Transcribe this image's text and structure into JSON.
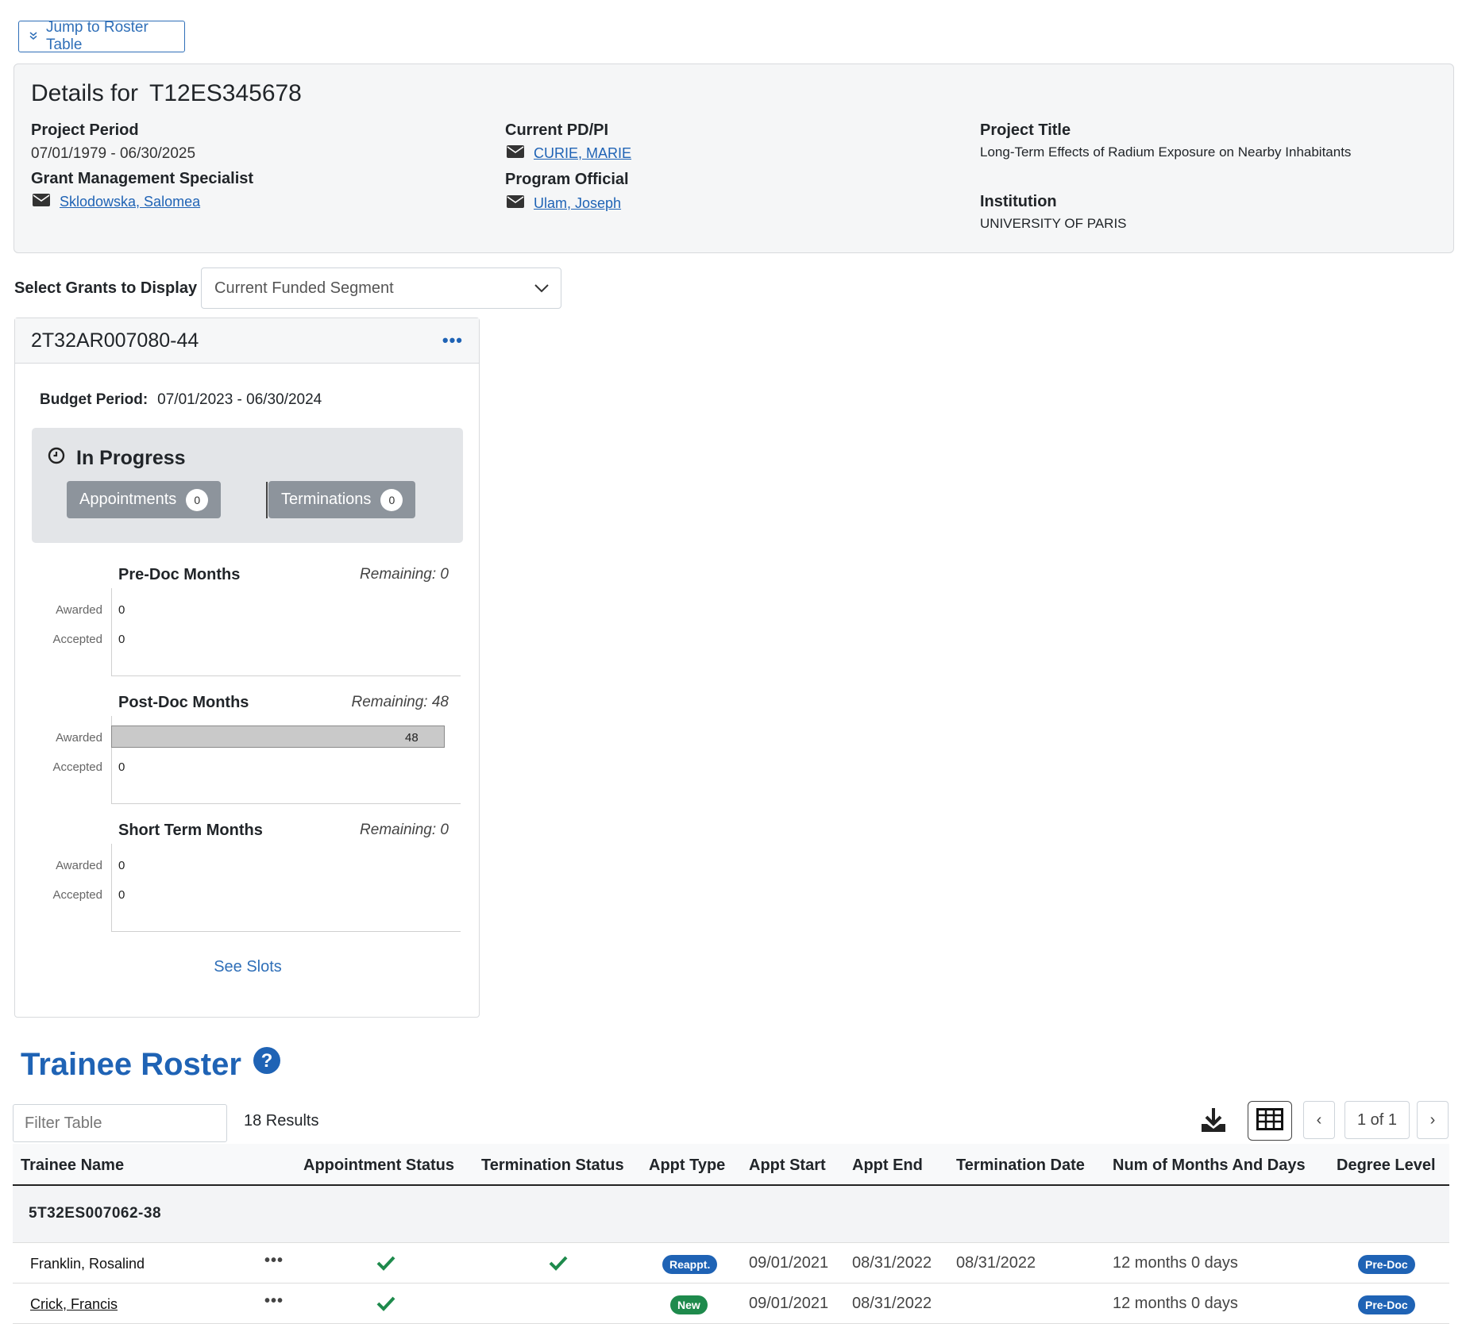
{
  "jump_button": {
    "label": "Jump to Roster Table"
  },
  "details": {
    "title_prefix": "Details for",
    "grant_number": "T12ES345678",
    "project_period": {
      "label": "Project Period",
      "value": "07/01/1979 - 06/30/2025"
    },
    "gms": {
      "label": "Grant Management Specialist",
      "name": "Sklodowska, Salomea"
    },
    "pdpi": {
      "label": "Current PD/PI",
      "name": "CURIE, MARIE"
    },
    "program_official": {
      "label": "Program Official",
      "name": "Ulam, Joseph"
    },
    "project_title": {
      "label": "Project Title",
      "value": "Long-Term Effects of Radium Exposure on Nearby Inhabitants"
    },
    "institution": {
      "label": "Institution",
      "value": "UNIVERSITY OF PARIS"
    }
  },
  "grant_select": {
    "label": "Select Grants to Display",
    "value": "Current Funded Segment"
  },
  "grant_card": {
    "grant_id": "2T32AR007080-44",
    "budget_label": "Budget Period:",
    "budget_value": "07/01/2023 - 06/30/2024",
    "in_progress": {
      "title": "In Progress",
      "appointments": {
        "label": "Appointments",
        "count": "0"
      },
      "terminations": {
        "label": "Terminations",
        "count": "0"
      }
    },
    "months": [
      {
        "title": "Pre-Doc Months",
        "remaining": "Remaining: 0",
        "awarded_label": "Awarded",
        "accepted_label": "Accepted",
        "awarded": "0",
        "accepted": "0",
        "awarded_fraction": 0
      },
      {
        "title": "Post-Doc Months",
        "remaining": "Remaining: 48",
        "awarded_label": "Awarded",
        "accepted_label": "Accepted",
        "awarded": "48",
        "accepted": "0",
        "awarded_fraction": 1
      },
      {
        "title": "Short Term Months",
        "remaining": "Remaining: 0",
        "awarded_label": "Awarded",
        "accepted_label": "Accepted",
        "awarded": "0",
        "accepted": "0",
        "awarded_fraction": 0
      }
    ],
    "see_slots": "See Slots"
  },
  "roster": {
    "title": "Trainee Roster",
    "filter_placeholder": "Filter Table",
    "results": "18 Results",
    "page_indicator": "1 of 1",
    "prev": "‹",
    "next": "›",
    "columns": [
      "Trainee Name",
      "Appointment Status",
      "Termination Status",
      "Appt Type",
      "Appt Start",
      "Appt End",
      "Termination Date",
      "Num of Months And Days",
      "Degree Level"
    ],
    "group": "5T32ES007062-38",
    "rows": [
      {
        "name": "Franklin, Rosalind",
        "appt_status": "check",
        "term_status": "check",
        "appt_type": "Reappt.",
        "appt_start": "09/01/2021",
        "appt_end": "08/31/2022",
        "term_date": "08/31/2022",
        "duration": "12 months 0 days",
        "degree": "Pre-Doc"
      },
      {
        "name": "Crick, Francis",
        "appt_status": "check",
        "term_status": "",
        "appt_type": "New",
        "appt_start": "09/01/2021",
        "appt_end": "08/31/2022",
        "term_date": "",
        "duration": "12 months 0 days",
        "degree": "Pre-Doc"
      }
    ]
  },
  "colors": {
    "link": "#1f63b5",
    "badge_reappt": "#1f63b5",
    "badge_new": "#1e8a4c",
    "badge_degree": "#1f63b5",
    "check": "#1e8a4c",
    "pill": "#8d949c"
  },
  "icons": [
    "chevron-double-down-icon",
    "envelope-icon",
    "clock-icon",
    "ellipsis-icon",
    "help-circle-icon",
    "download-icon",
    "table-grid-icon",
    "chevron-down-icon",
    "check-icon"
  ]
}
